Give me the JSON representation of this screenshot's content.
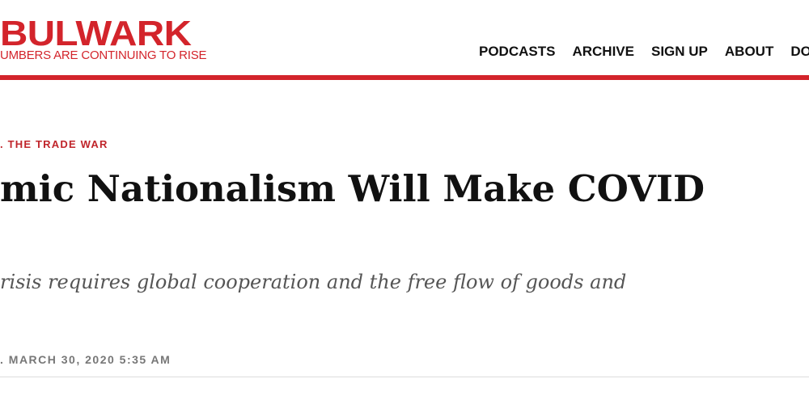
{
  "header": {
    "logo_text": "BULWARK",
    "tagline": "UMBERS ARE CONTINUING TO RISE"
  },
  "nav": {
    "items": [
      {
        "label": "PODCASTS"
      },
      {
        "label": "ARCHIVE"
      },
      {
        "label": "SIGN UP"
      },
      {
        "label": "ABOUT"
      },
      {
        "label": "DON"
      }
    ]
  },
  "article": {
    "kicker": ". THE TRADE WAR",
    "headline": "mic Nationalism Will Make COVID",
    "subhead": "risis requires global cooperation and the free flow of goods and",
    "byline": ". MARCH 30, 2020 5:35 AM"
  },
  "colors": {
    "brand_red": "#d3242b",
    "text_dark": "#111111",
    "subhead_gray": "#555555",
    "byline_gray": "#777777"
  }
}
